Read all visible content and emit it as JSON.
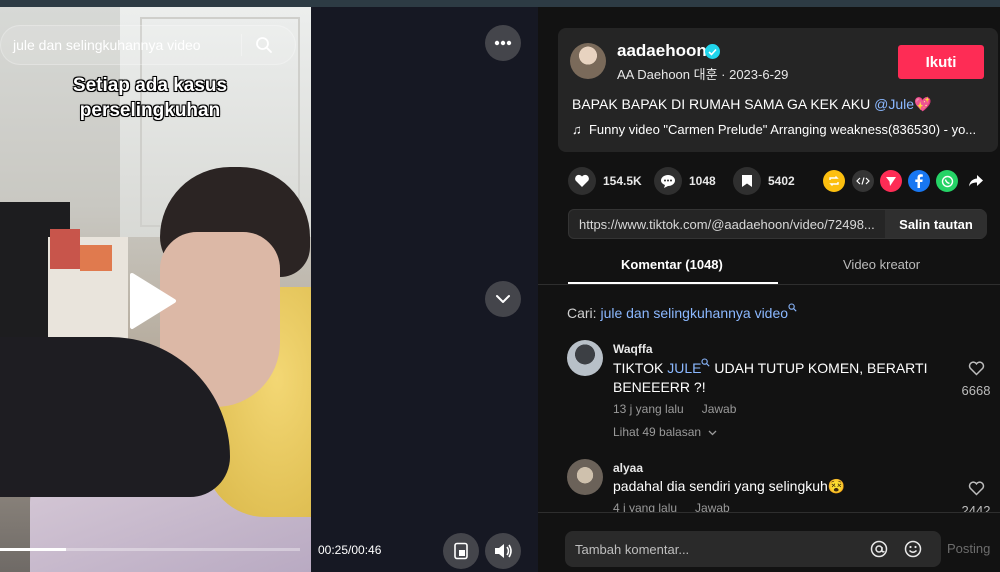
{
  "video": {
    "search_text": "jule dan selingkuhannya video",
    "caption_line1": "Setiap ada kasus",
    "caption_line2": "perselingkuhan",
    "time": "00:25/00:46",
    "progress_fraction": 0.22
  },
  "author": {
    "name": "aadaehoon",
    "sub": "AA Daehoon 대훈 · 2023-6-29",
    "follow_label": "Ikuti"
  },
  "description": {
    "text": "BAPAK BAPAK DI RUMAH SAMA GA KEK AKU ",
    "mention": "@Jule",
    "emoji": "💖",
    "music_note": "♫",
    "music": "Funny video \"Carmen Prelude\" Arranging weakness(836530) - yo..."
  },
  "stats": {
    "likes": "154.5K",
    "comments": "1048",
    "saves": "5402"
  },
  "share_icons": [
    {
      "name": "repost-icon",
      "color": "#fcbf0f"
    },
    {
      "name": "embed-icon",
      "color": "#353535"
    },
    {
      "name": "send-icon",
      "color": "#fe2c55"
    },
    {
      "name": "facebook-icon",
      "color": "#1877f2"
    },
    {
      "name": "whatsapp-icon",
      "color": "#25d366"
    },
    {
      "name": "share-arrow-icon",
      "color": "#121212"
    }
  ],
  "link": {
    "url": "https://www.tiktok.com/@aadaehoon/video/72498...",
    "copy_label": "Salin tautan"
  },
  "tabs": {
    "comments": "Komentar (1048)",
    "creator_videos": "Video kreator"
  },
  "search_hint": {
    "prefix": "Cari: ",
    "query": "jule dan selingkuhannya video"
  },
  "comments": [
    {
      "user": "Waqffa",
      "text_before": "TIKTOK ",
      "text_link": "JULE",
      "text_after": " UDAH TUTUP KOMEN, BERARTI BENEEERR ?!",
      "time": "13 j yang lalu",
      "reply": "Jawab",
      "view_replies": "Lihat 49 balasan",
      "likes": "6668"
    },
    {
      "user": "alyaa",
      "text": "padahal dia sendiri yang selingkuh",
      "emoji": "😵",
      "time": "4 j yang lalu",
      "reply": "Jawab",
      "likes": "2442"
    }
  ],
  "comment_box": {
    "placeholder": "Tambah komentar...",
    "post_label": "Posting"
  }
}
